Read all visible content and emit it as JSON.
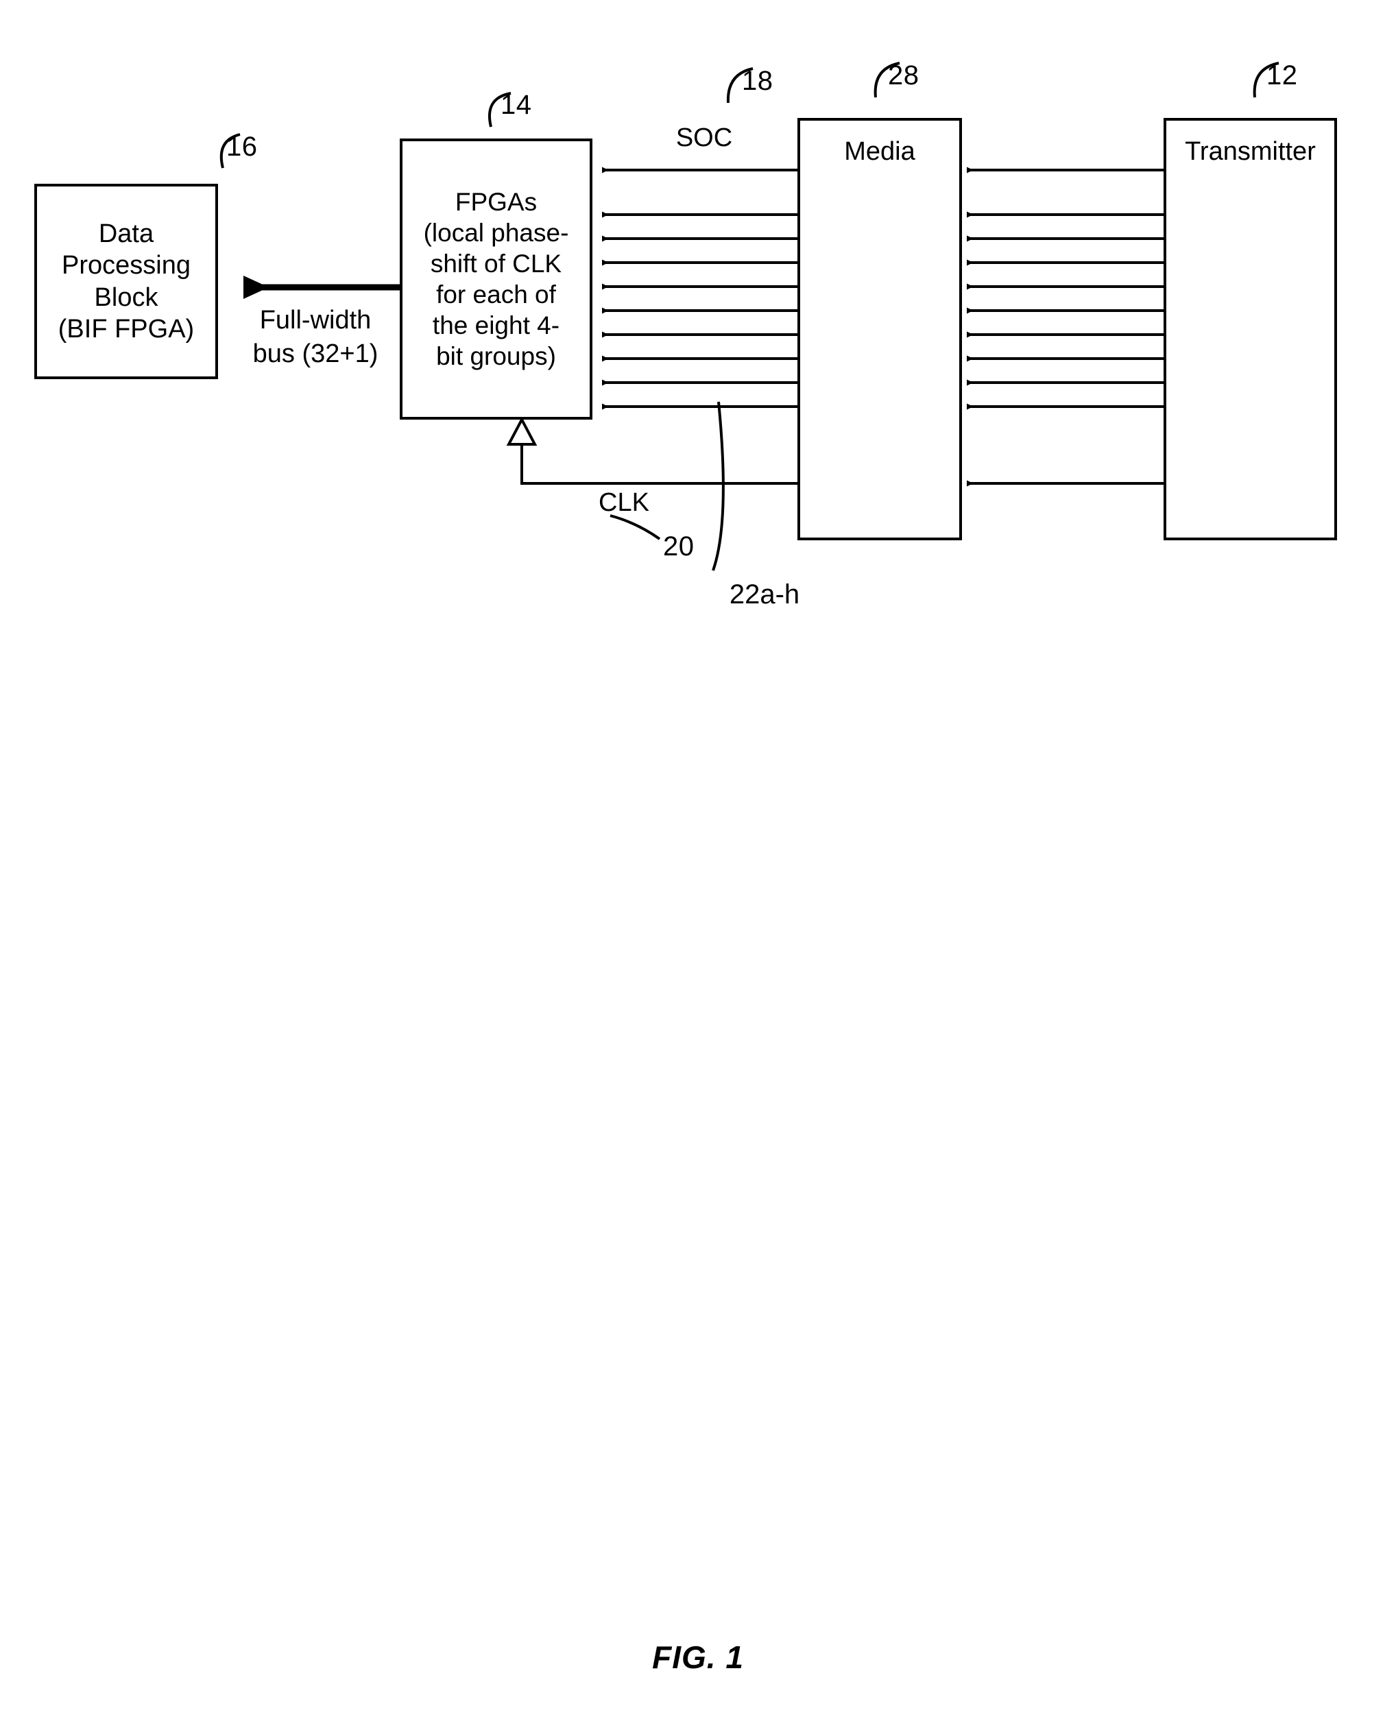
{
  "figure": {
    "caption": "FIG. 1"
  },
  "blocks": {
    "data_processing": {
      "label": "Data\nProcessing\nBlock\n(BIF FPGA)",
      "ref": "16"
    },
    "fpgas": {
      "label": "FPGAs\n(local phase-\nshift of CLK\nfor each of\nthe eight 4-\nbit groups)",
      "ref": "14"
    },
    "media": {
      "label": "Media",
      "ref": "28"
    },
    "transmitter": {
      "label": "Transmitter",
      "ref": "12"
    }
  },
  "signals": {
    "soc": {
      "label": "SOC",
      "ref": "18"
    },
    "clk": {
      "label": "CLK",
      "ref": "20"
    },
    "data_lines": {
      "ref": "22a-h"
    },
    "full_width_bus": {
      "label": "Full-width\nbus (32+1)"
    }
  },
  "colors": {
    "stroke": "#000000",
    "background": "#ffffff"
  }
}
